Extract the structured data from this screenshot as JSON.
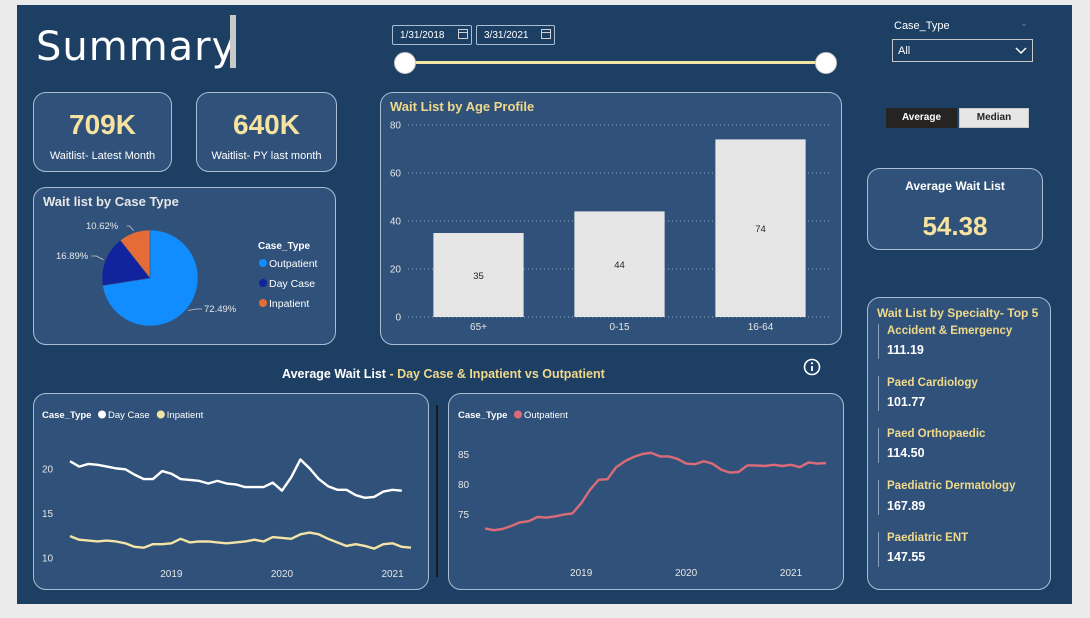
{
  "page": {
    "title": "Summary"
  },
  "date_range": {
    "start": "1/31/2018",
    "end": "3/31/2021",
    "start_pos": 0.0,
    "end_pos": 1.0
  },
  "filter": {
    "label": "Case_Type",
    "value": "All"
  },
  "toggle": {
    "average_label": "Average",
    "median_label": "Median",
    "selected": "Average"
  },
  "kpis": [
    {
      "value": "709K",
      "label": "Waitlist- Latest Month"
    },
    {
      "value": "640K",
      "label": "Waitlist- PY last month"
    }
  ],
  "avg_card": {
    "label": "Average Wait List",
    "value": "54.38"
  },
  "pie": {
    "title": "Wait list by Case Type",
    "legend_title": "Case_Type",
    "chart_data": {
      "type": "pie",
      "labels": [
        "Outpatient",
        "Day Case",
        "Inpatient"
      ],
      "values": [
        72.49,
        16.89,
        10.62
      ],
      "value_labels": [
        "72.49%",
        "16.89%",
        "10.62%"
      ],
      "colors": [
        "#118dff",
        "#12239e",
        "#e66c37"
      ]
    }
  },
  "bar": {
    "title": "Wait List by Age Profile",
    "chart_data": {
      "type": "bar",
      "categories": [
        "65+",
        "0-15",
        "16-64"
      ],
      "values": [
        35,
        44,
        74
      ],
      "ylim": [
        0,
        80
      ],
      "yticks": [
        0,
        20,
        40,
        60,
        80
      ],
      "color": "#e6e6e6"
    }
  },
  "line_section": {
    "heading_part1": "Average Wait List",
    "heading_part2": " - Day Case & Inpatient vs Outpatient",
    "info_icon": "info-icon"
  },
  "line1": {
    "legend_title": "Case_Type",
    "chart_data": {
      "type": "line",
      "x_start": "2018-02",
      "x_ticks": [
        "2019",
        "2020",
        "2021"
      ],
      "ylim": [
        9.5,
        21.5
      ],
      "yticks": [
        10,
        15,
        20
      ],
      "series": [
        {
          "name": "Day Case",
          "color": "#ffffff",
          "values": [
            20.8,
            20.2,
            20.5,
            20.4,
            20.2,
            20.0,
            19.9,
            19.3,
            18.8,
            18.8,
            19.7,
            19.4,
            18.8,
            18.7,
            18.6,
            18.3,
            18.6,
            18.3,
            18.2,
            17.9,
            17.9,
            17.9,
            18.4,
            17.5,
            19.0,
            21.0,
            20.0,
            18.8,
            18.0,
            17.6,
            17.6,
            17.0,
            16.7,
            16.8,
            17.4,
            17.6,
            17.5
          ]
        },
        {
          "name": "Inpatient",
          "color": "#f2e4a5",
          "values": [
            12.4,
            12.0,
            11.9,
            11.8,
            11.9,
            11.8,
            11.6,
            11.2,
            11.1,
            11.5,
            11.5,
            11.6,
            12.1,
            11.7,
            11.8,
            11.8,
            11.7,
            11.6,
            11.7,
            11.8,
            12.0,
            11.8,
            12.3,
            12.2,
            12.1,
            12.6,
            12.8,
            12.6,
            12.1,
            11.7,
            11.3,
            11.5,
            11.3,
            11.0,
            11.5,
            11.6,
            11.2,
            11.1
          ]
        }
      ]
    }
  },
  "line2": {
    "legend_title": "Case_Type",
    "chart_data": {
      "type": "line",
      "x_start": "2018-02",
      "x_ticks": [
        "2019",
        "2020",
        "2021"
      ],
      "ylim": [
        71.5,
        87
      ],
      "yticks": [
        75,
        80,
        85
      ],
      "series": [
        {
          "name": "Outpatient",
          "color": "#dc6b78",
          "values": [
            72.6,
            72.3,
            72.5,
            73.0,
            73.6,
            73.8,
            74.5,
            74.4,
            74.6,
            74.9,
            75.1,
            76.8,
            79.0,
            80.7,
            80.8,
            82.8,
            83.8,
            84.5,
            85.0,
            85.2,
            84.6,
            84.6,
            84.2,
            83.4,
            83.3,
            83.8,
            83.4,
            82.4,
            81.9,
            82.0,
            83.1,
            83.1,
            83.0,
            83.2,
            83.0,
            83.2,
            82.8,
            83.6,
            83.4,
            83.5
          ]
        }
      ]
    }
  },
  "specialty": {
    "title": "Wait List by Specialty- Top 5",
    "items": [
      {
        "name": "Accident & Emergency",
        "value": "111.19"
      },
      {
        "name": "Paed Cardiology",
        "value": "101.77"
      },
      {
        "name": "Paed Orthopaedic",
        "value": "114.50"
      },
      {
        "name": "Paediatric Dermatology",
        "value": "167.89"
      },
      {
        "name": "Paediatric ENT",
        "value": "147.55"
      }
    ]
  }
}
